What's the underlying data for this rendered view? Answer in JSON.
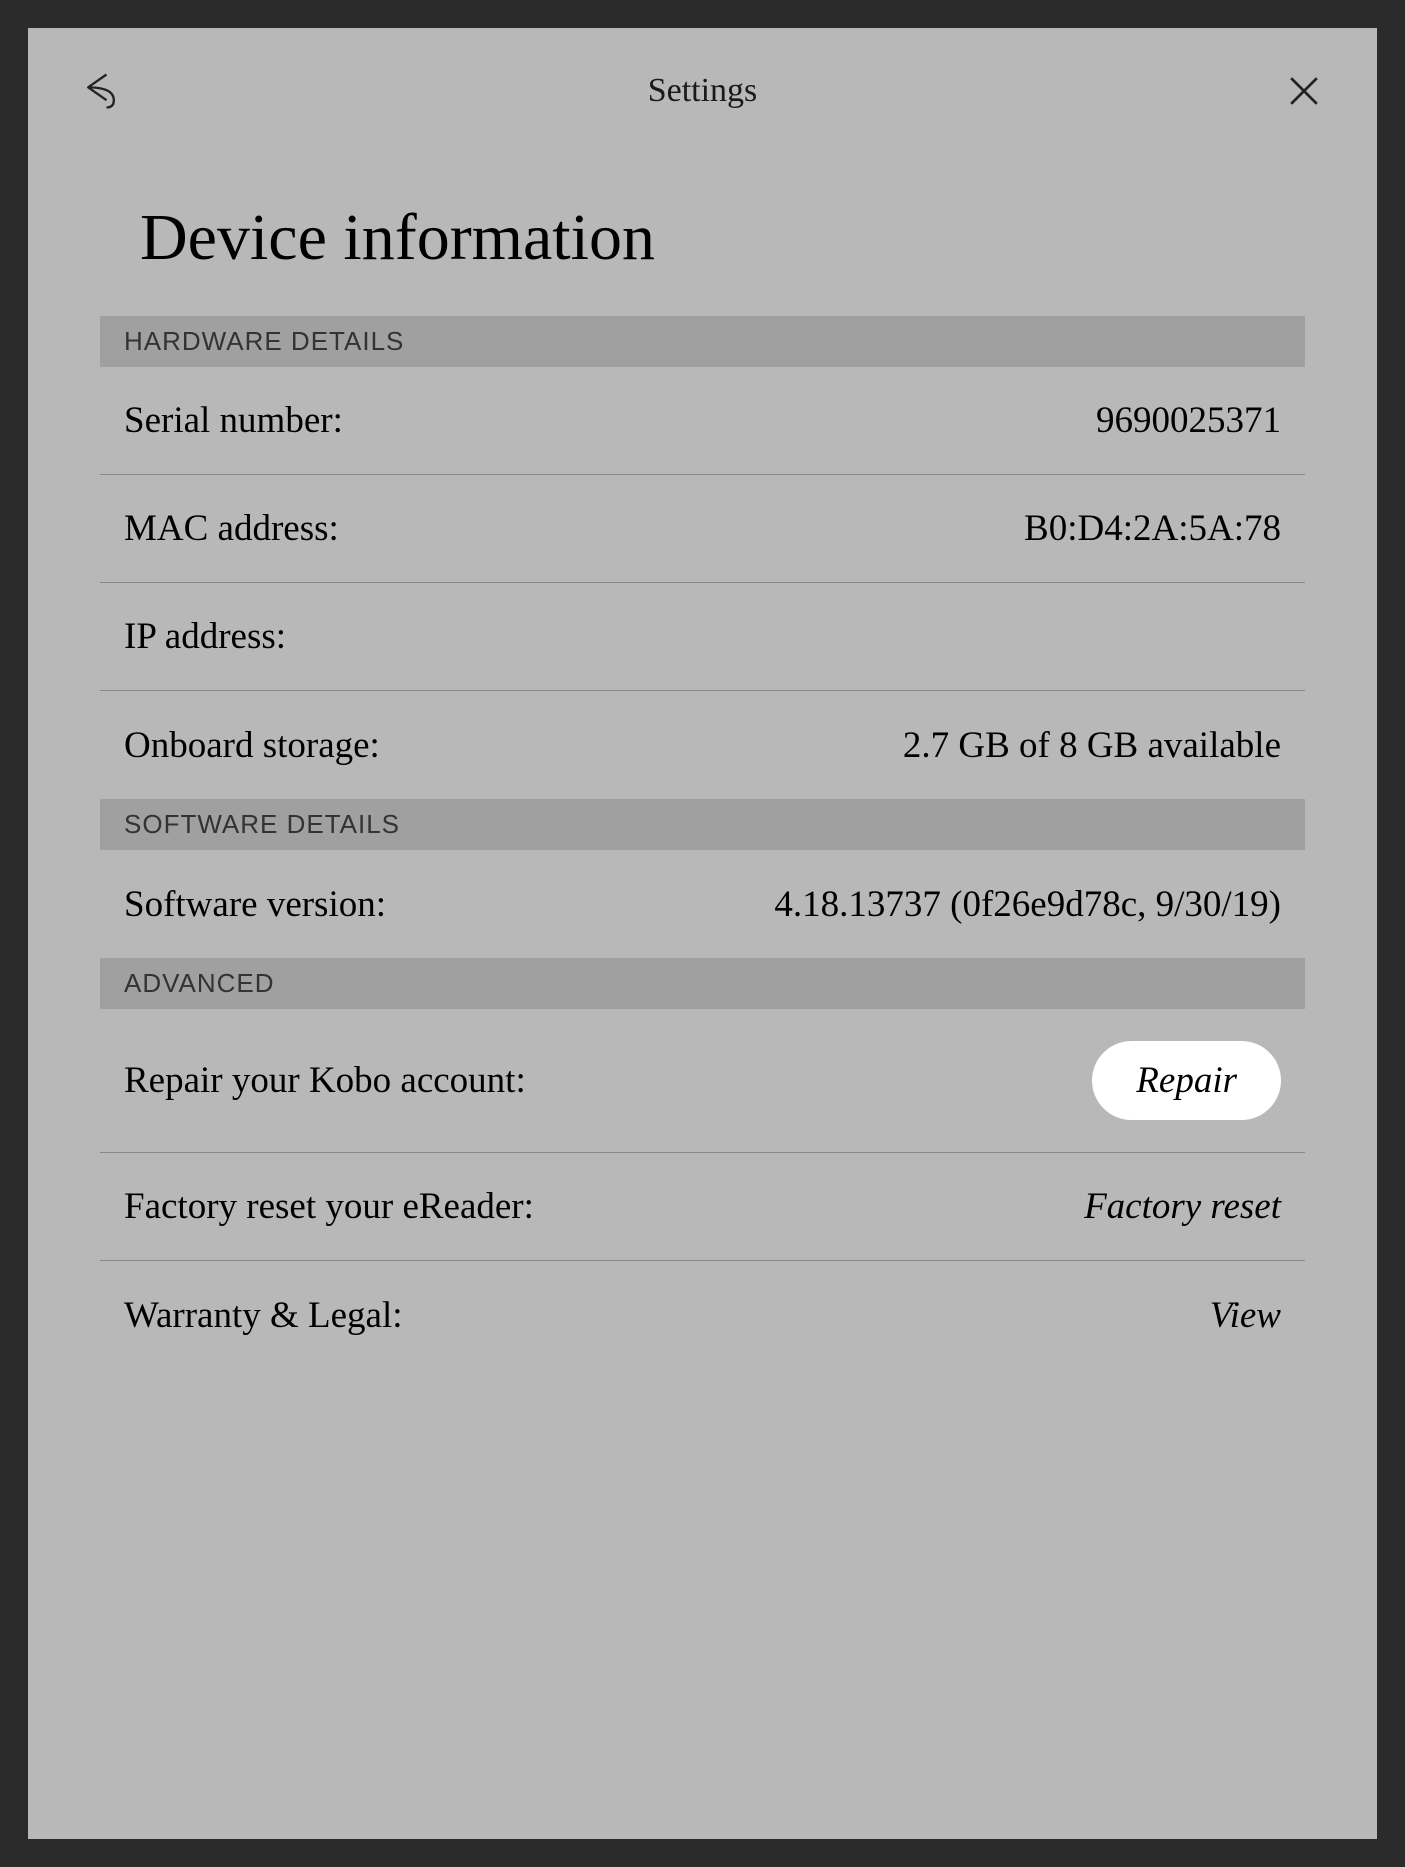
{
  "header": {
    "title": "Settings"
  },
  "page": {
    "title": "Device information"
  },
  "sections": {
    "hardware": {
      "header": "HARDWARE DETAILS",
      "serial_label": "Serial number:",
      "serial_value": "9690025371",
      "mac_label": "MAC address:",
      "mac_value": "B0:D4:2A:5A:78",
      "ip_label": "IP address:",
      "ip_value": "",
      "storage_label": "Onboard storage:",
      "storage_value": "2.7 GB of 8 GB available"
    },
    "software": {
      "header": "SOFTWARE DETAILS",
      "version_label": "Software version:",
      "version_value": "4.18.13737 (0f26e9d78c, 9/30/19)"
    },
    "advanced": {
      "header": "ADVANCED",
      "repair_label": "Repair your Kobo account:",
      "repair_action": "Repair",
      "factory_label": "Factory reset your eReader:",
      "factory_action": "Factory reset",
      "warranty_label": "Warranty & Legal:",
      "warranty_action": "View"
    }
  }
}
